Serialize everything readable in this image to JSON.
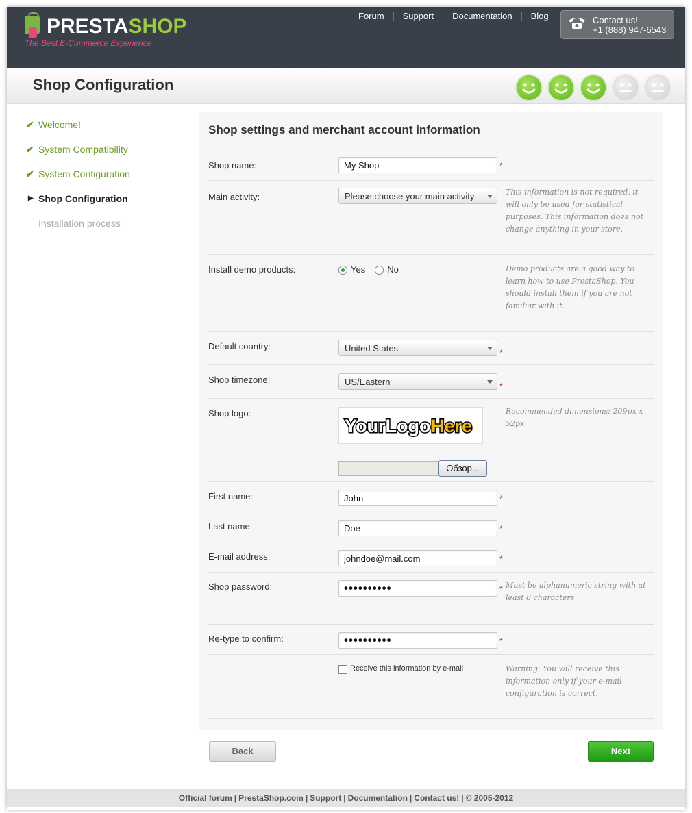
{
  "header": {
    "brand_part1": "PRESTA",
    "brand_part2": "SHOP",
    "tagline": "The Best E-Commerce Experience",
    "nav": [
      "Forum",
      "Support",
      "Documentation",
      "Blog"
    ],
    "contact_label": "Contact us!",
    "contact_phone": "+1 (888) 947-6543"
  },
  "page": {
    "title": "Shop Configuration",
    "progress": {
      "completed": 3,
      "total": 5
    }
  },
  "steps": [
    {
      "label": "Welcome!",
      "state": "done"
    },
    {
      "label": "System Compatibility",
      "state": "done"
    },
    {
      "label": "System Configuration",
      "state": "done"
    },
    {
      "label": "Shop Configuration",
      "state": "current"
    },
    {
      "label": "Installation process",
      "state": "pending"
    }
  ],
  "form": {
    "heading": "Shop settings and merchant account information",
    "shop_name": {
      "label": "Shop name:",
      "value": "My Shop"
    },
    "main_activity": {
      "label": "Main activity:",
      "value": "Please choose your main activity",
      "help": "This information is not required, it will only be used for statistical purposes. This information does not change anything in your store."
    },
    "demo_products": {
      "label": "Install demo products:",
      "yes": "Yes",
      "no": "No",
      "selected": "Yes",
      "help": "Demo products are a good way to learn how to use PrestaShop. You should install them if you are not familiar with it."
    },
    "country": {
      "label": "Default country:",
      "value": "United States"
    },
    "timezone": {
      "label": "Shop timezone:",
      "value": "US/Eastern"
    },
    "logo": {
      "label": "Shop logo:",
      "logo_text_1": "YourLogo",
      "logo_text_2": "Here",
      "help": "Recommended dimensions: 209px x 52px",
      "browse": "Обзор..."
    },
    "first_name": {
      "label": "First name:",
      "value": "John"
    },
    "last_name": {
      "label": "Last name:",
      "value": "Doe"
    },
    "email": {
      "label": "E-mail address:",
      "value": "johndoe@mail.com"
    },
    "password": {
      "label": "Shop password:",
      "value": "••••••••••",
      "help": "Must be alphanumeric string with at least 8 characters"
    },
    "confirm": {
      "label": "Re-type to confirm:",
      "value": "••••••••••"
    },
    "receive_info": {
      "label": "Receive this information by e-mail",
      "checked": false,
      "help": "Warning: You will receive this information only if your e-mail configuration is correct."
    },
    "required_mark": "*"
  },
  "buttons": {
    "back": "Back",
    "next": "Next"
  },
  "footer": {
    "links": [
      "Official forum",
      "PrestaShop.com",
      "Support",
      "Documentation",
      "Contact us!"
    ],
    "copyright": "© 2005-2012"
  },
  "colors": {
    "header_bg": "#394049",
    "accent_green": "#6a9c1f",
    "brand_pink": "#e8467c",
    "next_button": "#1f9a12"
  }
}
